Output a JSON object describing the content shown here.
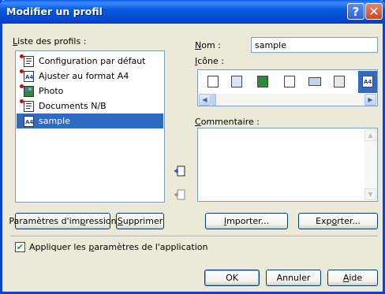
{
  "window": {
    "title": "Modifier un profil",
    "help_glyph": "?",
    "close_glyph": "✕"
  },
  "profiles": {
    "label_prefix": "L",
    "label_rest": "iste des profils :",
    "items": [
      {
        "label": "Configuration par défaut",
        "icon": "document-icon",
        "marker": true
      },
      {
        "label": "Ajuster au format A4",
        "icon": "a4-icon",
        "marker": true
      },
      {
        "label": "Photo",
        "icon": "photo-icon",
        "marker": true
      },
      {
        "label": "Documents N/B",
        "icon": "document-icon",
        "marker": true
      },
      {
        "label": "sample",
        "icon": "a4-icon",
        "marker": false,
        "selected": true
      }
    ]
  },
  "name": {
    "label_prefix": "N",
    "label_rest": "om :",
    "value": "sample"
  },
  "icon_picker": {
    "label_prefix": "I",
    "label_rest": "cône :",
    "left_arrow": "◀",
    "right_arrow": "▶"
  },
  "comment": {
    "label_prefix": "C",
    "label_rest": "ommentaire :",
    "up_arrow": "▲",
    "down_arrow": "▼"
  },
  "buttons": {
    "print_settings_a": "Paramètres d'im",
    "print_settings_u": "p",
    "print_settings_b": "ression",
    "delete_u": "S",
    "delete_rest": "upprimer",
    "import_u": "I",
    "import_rest": "mporter...",
    "export_a": "Exp",
    "export_u": "o",
    "export_b": "rter...",
    "ok": "OK",
    "cancel": "Annuler",
    "help_u": "A",
    "help_rest": "ide"
  },
  "apply_checkbox": {
    "checked": true,
    "check_glyph": "✔",
    "label_a": "Appliquer les ",
    "label_u": "p",
    "label_b": "aramètres de l'application"
  },
  "colors": {
    "titlebar": "#0A59E0",
    "selection": "#316AC5",
    "face": "#ECE9D8"
  }
}
